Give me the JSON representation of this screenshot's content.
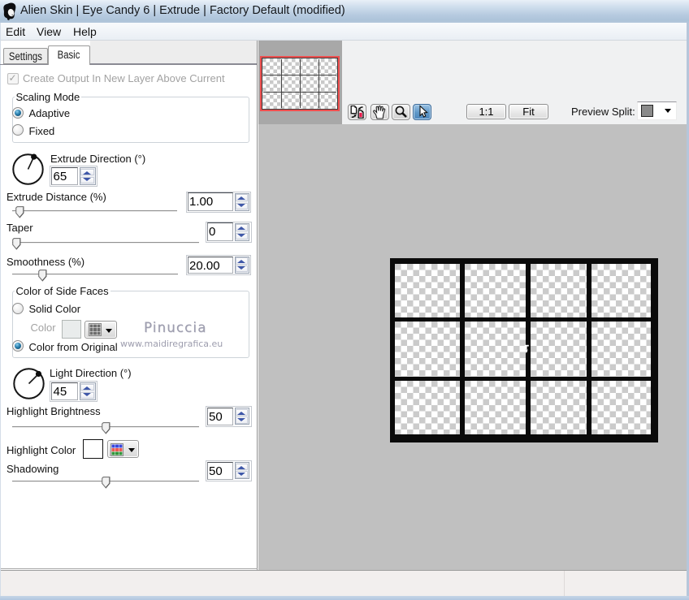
{
  "window": {
    "title": "Alien Skin | Eye Candy 6 | Extrude | Factory Default (modified)",
    "icon": "alien-skin-ghost-logo"
  },
  "menu": {
    "items": [
      {
        "label": "Edit"
      },
      {
        "label": "View"
      },
      {
        "label": "Help"
      }
    ]
  },
  "tabs": [
    {
      "label": "Settings",
      "active": false
    },
    {
      "label": "Basic",
      "active": true
    }
  ],
  "panel": {
    "create_output": {
      "label": "Create Output In New Layer Above Current",
      "checked": true,
      "disabled": true
    },
    "scaling_mode": {
      "label": "Scaling Mode",
      "options": [
        {
          "label": "Adaptive",
          "selected": true
        },
        {
          "label": "Fixed",
          "selected": false
        }
      ]
    },
    "extrude_direction": {
      "label": "Extrude Direction (°)",
      "value": "65",
      "degrees": 65
    },
    "extrude_distance": {
      "label": "Extrude Distance (%)",
      "value": "1.00",
      "slider_percent": 1
    },
    "taper": {
      "label": "Taper",
      "value": "0",
      "slider_percent": 0
    },
    "smoothness": {
      "label": "Smoothness (%)",
      "value": "20.00",
      "slider_percent": 20
    },
    "color_of_side_faces": {
      "label": "Color of Side Faces",
      "options": [
        {
          "label": "Solid Color",
          "selected": false
        },
        {
          "label": "Color from Original",
          "selected": true
        }
      ],
      "color_label": "Color",
      "color_swatch": "#e8ecef",
      "disabled": true
    },
    "light_direction": {
      "label": "Light Direction (°)",
      "value": "45",
      "degrees": 45
    },
    "highlight_brightness": {
      "label": "Highlight Brightness",
      "value": "50",
      "slider_percent": 50
    },
    "highlight_color": {
      "label": "Highlight Color",
      "swatch": "#ffffff"
    },
    "shadowing": {
      "label": "Shadowing",
      "value": "50",
      "slider_percent": 50
    },
    "watermark": {
      "line1": "Pinuccia",
      "line2": "www.maidiregrafica.eu"
    }
  },
  "toolbar": {
    "icons": [
      {
        "name": "swap-preview"
      },
      {
        "name": "pan-hand"
      },
      {
        "name": "zoom-magnifier"
      },
      {
        "name": "pointer-arrow",
        "selected": true
      }
    ],
    "buttons": [
      {
        "label": "1:1"
      },
      {
        "label": "Fit"
      }
    ],
    "preview_split": {
      "label": "Preview Split:",
      "swatch": "#8a8a8a"
    }
  },
  "preview": {
    "background": "#c0c0c0",
    "image": {
      "columns": 4,
      "rows": 3,
      "frame_color": "#0a0a0a",
      "cells": "transparent-checkerboard"
    },
    "navigator": {
      "border_color": "#ee4f4f"
    }
  },
  "colors": {
    "titlebar_top": "#e8f0f8",
    "titlebar_bottom": "#adc3d9",
    "panel_bg": "#ffffff",
    "preview_bg": "#c0c0c0",
    "nav_pad": "#a8a8a8",
    "toolstrip": "#f0f1f2",
    "statusbar": "#f2efee",
    "frame_blue": "#b2c7e0",
    "selected_tool_blue": "#5e97c8",
    "spinner_arrow": "#39549c"
  }
}
